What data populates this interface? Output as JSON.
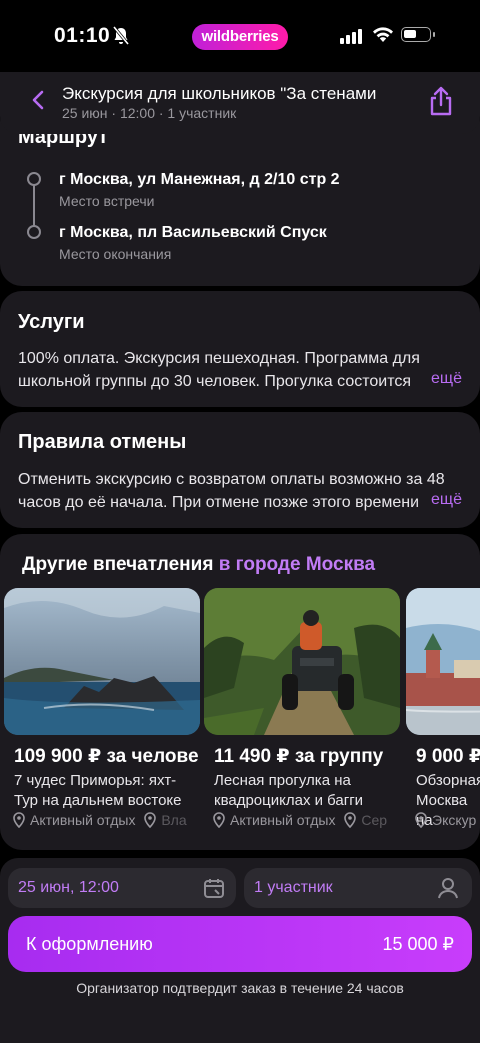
{
  "status": {
    "time": "01:10",
    "brand": "wildberries",
    "battery_level": 0.45
  },
  "header": {
    "title": "Экскурсия для школьников \"За стенами",
    "subtitle": "25 июн · 12:00 · 1 участник"
  },
  "route": {
    "title": "Маршрут",
    "stops": [
      {
        "address": "г Москва, ул Манежная, д 2/10 стр 2",
        "label": "Место встречи"
      },
      {
        "address": "г Москва, пл Васильевский Спуск",
        "label": "Место окончания"
      }
    ]
  },
  "services": {
    "title": "Услуги",
    "line1": "100% оплата. Экскурсия пешеходная. Программа для",
    "line2": "школьной группы до 30 человек. Прогулка состоится",
    "more": "ещё"
  },
  "cancel": {
    "title": "Правила отмены",
    "line1": "Отменить экскурсию с возвратом оплаты возможно за 48",
    "line2": "часов до её начала. При отмене позже этого времени",
    "more": "ещё"
  },
  "other": {
    "title": "Другие впечатления",
    "title_accent": "в городе Москва",
    "items": [
      {
        "price": "109 900 ₽ за челове",
        "name": "7 чудес Приморья: яхт-Тур на дальнем востоке",
        "category": "Активный отдых",
        "place": "Вла"
      },
      {
        "price": "11 490 ₽ за группу",
        "name": "Лесная прогулка на квадроциклах и багги",
        "category": "Активный отдых",
        "place": "Сер"
      },
      {
        "price": "9 000 ₽",
        "name": "Обзорная Москва на",
        "category": "Экскур",
        "place": ""
      }
    ]
  },
  "booking": {
    "date": "25 июн, 12:00",
    "participants": "1 участник",
    "cta_label": "К оформлению",
    "cta_price": "15 000 ₽",
    "note": "Организатор подтвердит заказ в течение 24 часов"
  }
}
